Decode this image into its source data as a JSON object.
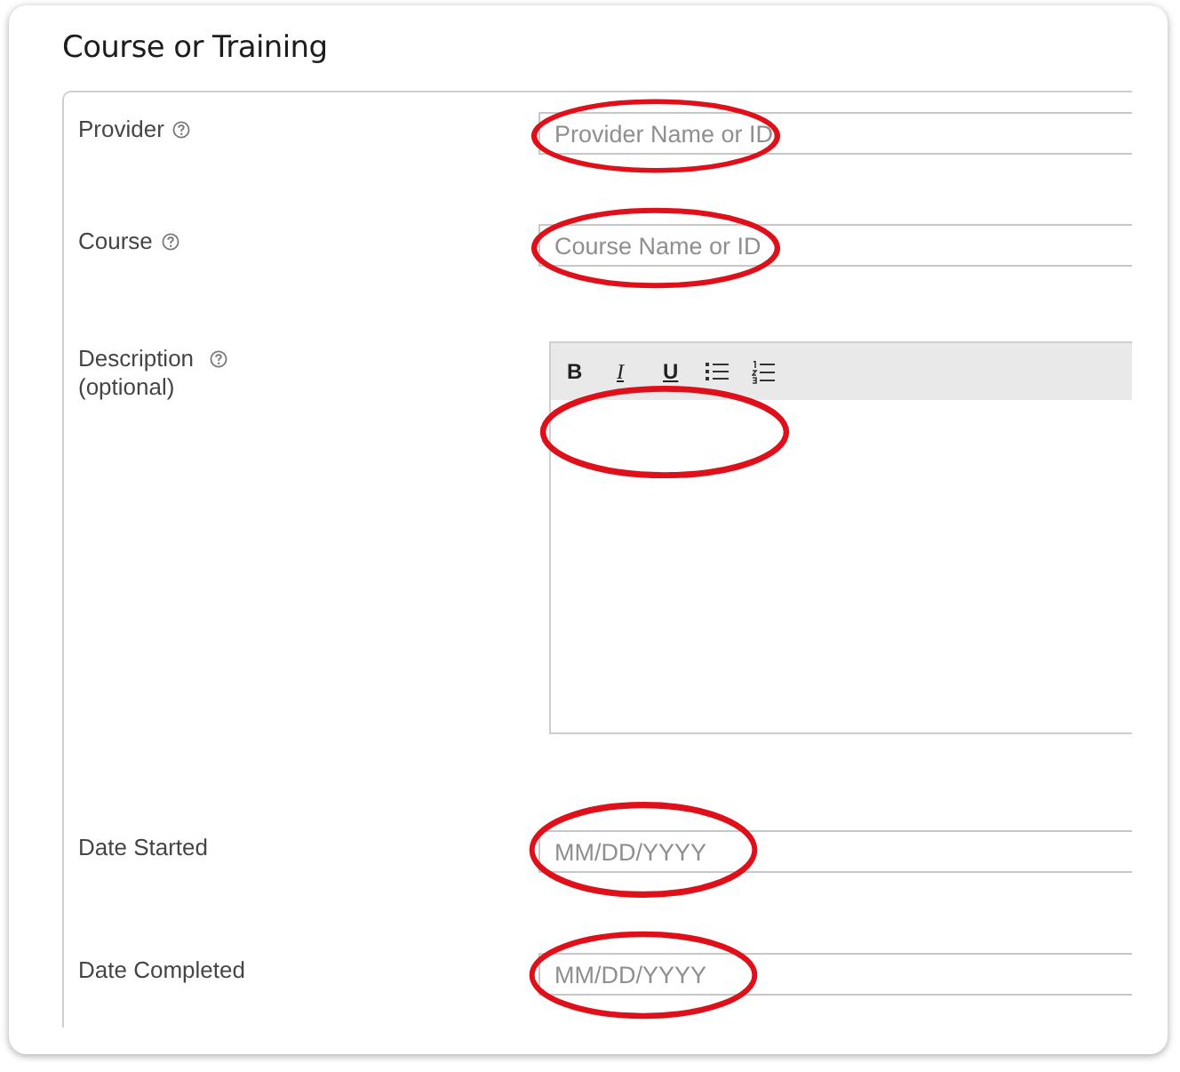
{
  "title": "Course or Training",
  "fields": [
    {
      "kind": "input",
      "label": "Provider",
      "help": true,
      "placeholder": "Provider Name or ID",
      "circled": true
    },
    {
      "kind": "input",
      "label": "Course",
      "help": true,
      "placeholder": "Course Name or ID",
      "circled": true
    },
    {
      "kind": "editor",
      "label": "Description",
      "sublabel": "(optional)",
      "help": true,
      "circled": true,
      "toolbar": [
        {
          "kind": "bold",
          "label": "B"
        },
        {
          "kind": "italic",
          "label": "I"
        },
        {
          "kind": "underline",
          "label": "U"
        },
        {
          "kind": "bullet-list"
        },
        {
          "kind": "numbered-list"
        }
      ]
    },
    {
      "kind": "date",
      "label": "Date Started",
      "help": false,
      "placeholder": "MM/DD/YYYY",
      "circled": true
    },
    {
      "kind": "date",
      "label": "Date Completed",
      "help": false,
      "placeholder": "MM/DD/YYYY",
      "circled": true
    }
  ]
}
